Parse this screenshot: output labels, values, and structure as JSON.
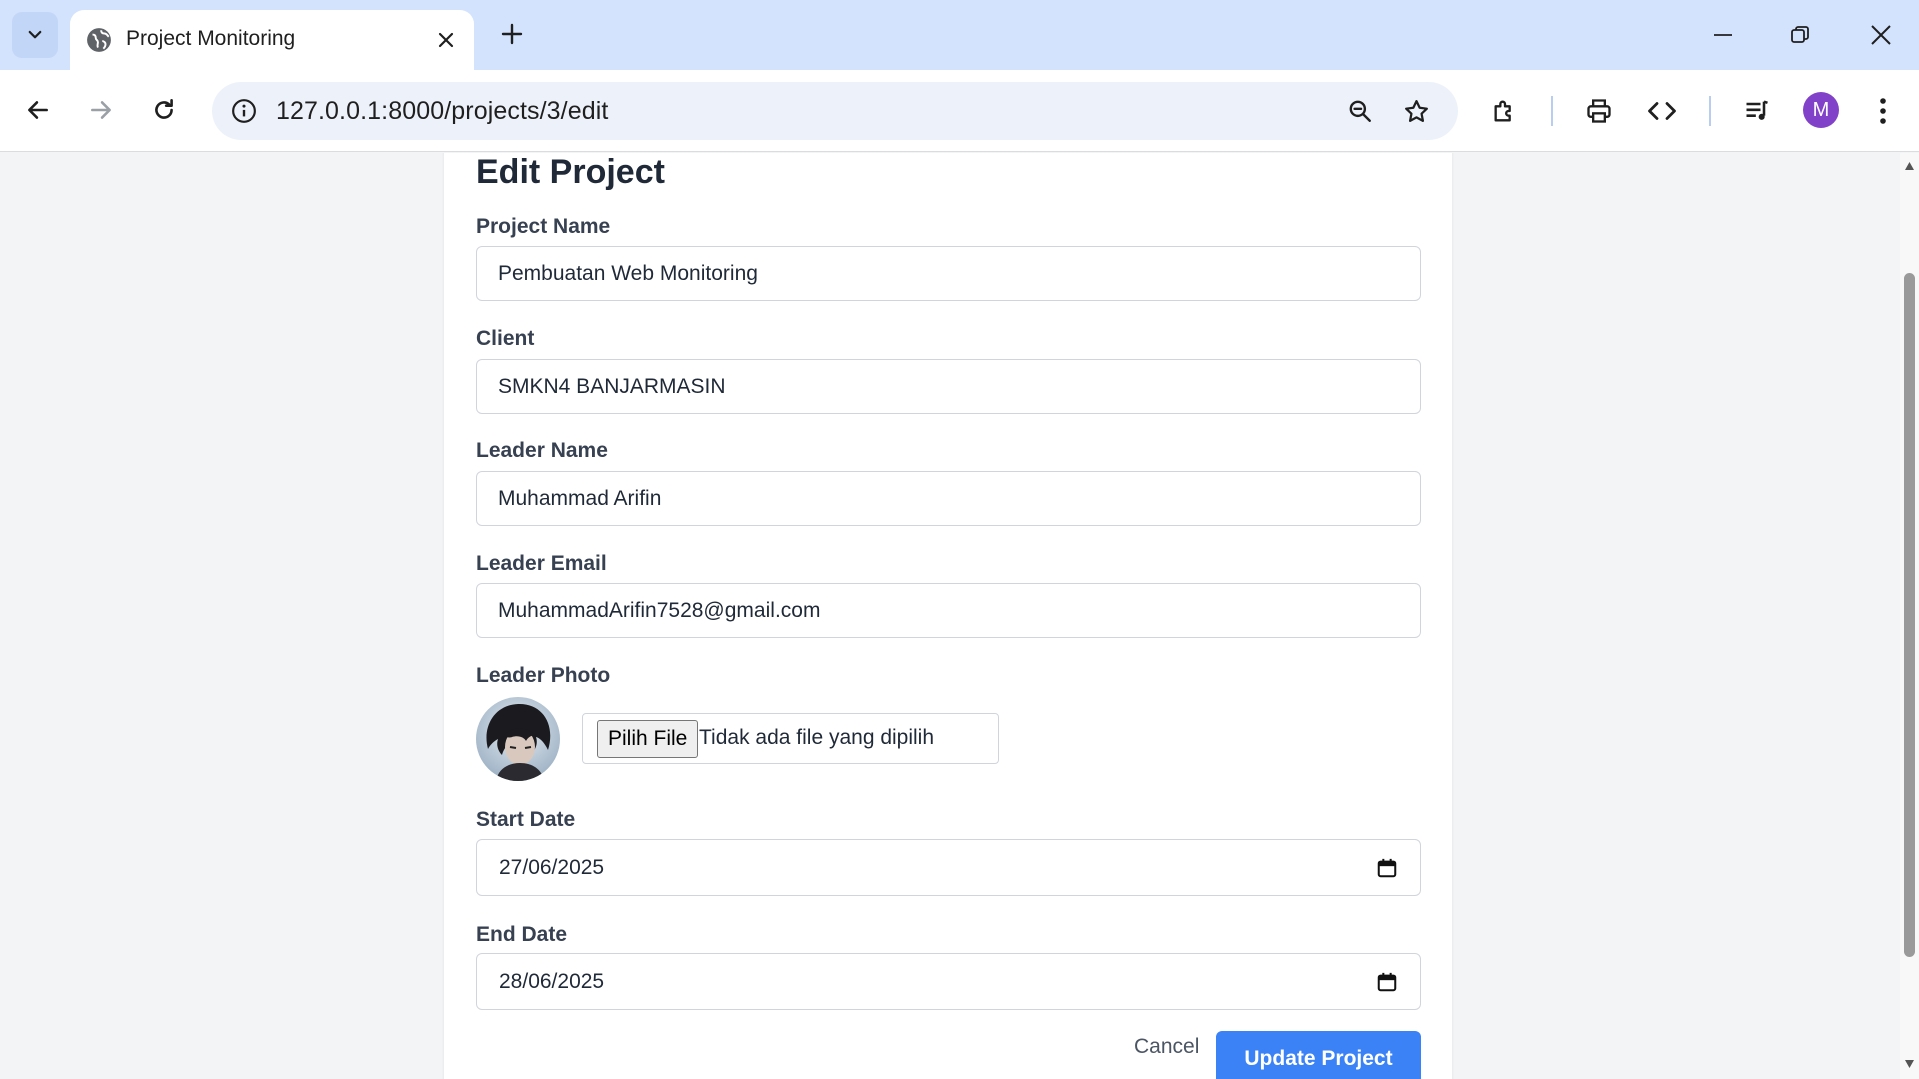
{
  "browser": {
    "tab_title": "Project Monitoring",
    "url": "127.0.0.1:8000/projects/3/edit",
    "profile_initial": "M"
  },
  "page": {
    "title": "Edit Project",
    "fields": {
      "project_name": {
        "label": "Project Name",
        "value": "Pembuatan Web Monitoring"
      },
      "client": {
        "label": "Client",
        "value": "SMKN4 BANJARMASIN"
      },
      "leader_name": {
        "label": "Leader Name",
        "value": "Muhammad Arifin"
      },
      "leader_email": {
        "label": "Leader Email",
        "value": "MuhammadArifin7528@gmail.com"
      },
      "leader_photo": {
        "label": "Leader Photo",
        "button": "Pilih File",
        "status": "Tidak ada file yang dipilih"
      },
      "start_date": {
        "label": "Start Date",
        "value": "27/06/2025"
      },
      "end_date": {
        "label": "End Date",
        "value": "28/06/2025"
      }
    },
    "actions": {
      "cancel": "Cancel",
      "submit": "Update Project"
    }
  },
  "colors": {
    "tabstrip": "#d3e3fd",
    "primary_button": "#3b82f6",
    "avatar": "#8142c9"
  },
  "icons": [
    "tab-search-icon",
    "globe-icon",
    "close-icon",
    "plus-icon",
    "minimize-icon",
    "restore-icon",
    "window-close-icon",
    "back-icon",
    "forward-icon",
    "reload-icon",
    "site-info-icon",
    "zoom-icon",
    "star-icon",
    "extensions-icon",
    "print-icon",
    "code-icon",
    "media-queue-icon",
    "more-vert-icon",
    "calendar-icon"
  ]
}
